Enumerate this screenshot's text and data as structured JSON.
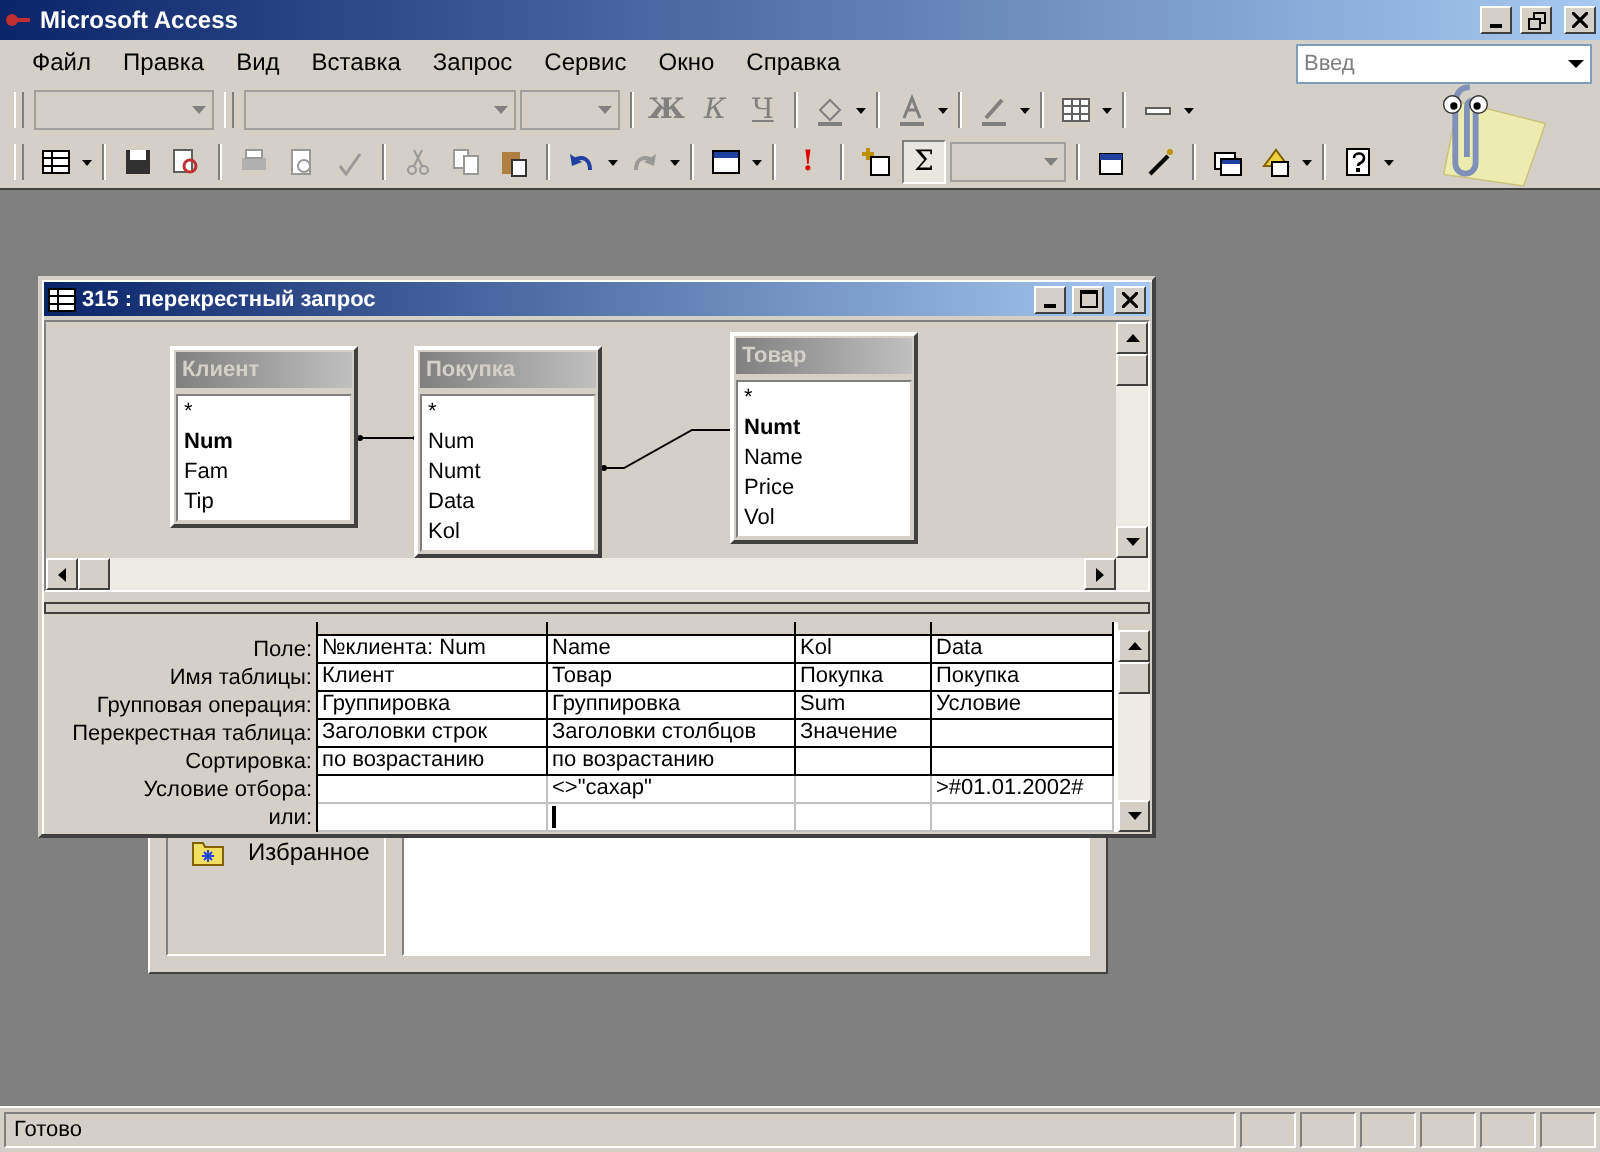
{
  "window": {
    "title": "Microsoft Access"
  },
  "menu": [
    {
      "label": "Файл"
    },
    {
      "label": "Правка"
    },
    {
      "label": "Вид"
    },
    {
      "label": "Вставка"
    },
    {
      "label": "Запрос"
    },
    {
      "label": "Сервис"
    },
    {
      "label": "Окно"
    },
    {
      "label": "Справка"
    }
  ],
  "help_box": {
    "placeholder": "Введ"
  },
  "formatting_toolbar": {
    "glyphs": [
      "Ж",
      "К",
      "Ч"
    ]
  },
  "query_toolbar": {
    "run_glyph": "!",
    "totals_glyph": "Σ"
  },
  "query_window": {
    "title": "315 : перекрестный запрос",
    "tables": [
      {
        "name": "Клиент",
        "fields": [
          {
            "name": "*",
            "key": false
          },
          {
            "name": "Num",
            "key": true
          },
          {
            "name": "Fam",
            "key": false
          },
          {
            "name": "Tip",
            "key": false
          }
        ]
      },
      {
        "name": "Покупка",
        "fields": [
          {
            "name": "*",
            "key": false
          },
          {
            "name": "Num",
            "key": false
          },
          {
            "name": "Numt",
            "key": false
          },
          {
            "name": "Data",
            "key": false
          },
          {
            "name": "Kol",
            "key": false
          }
        ]
      },
      {
        "name": "Товар",
        "fields": [
          {
            "name": "*",
            "key": false
          },
          {
            "name": "Numt",
            "key": true
          },
          {
            "name": "Name",
            "key": false
          },
          {
            "name": "Price",
            "key": false
          },
          {
            "name": "Vol",
            "key": false
          }
        ]
      }
    ],
    "grid": {
      "row_labels": [
        "Поле:",
        "Имя таблицы:",
        "Групповая операция:",
        "Перекрестная таблица:",
        "Сортировка:",
        "Условие отбора:",
        "или:"
      ],
      "columns": [
        {
          "cells": [
            "№клиента: Num",
            "Клиент",
            "Группировка",
            "Заголовки строк",
            "по возрастанию",
            "",
            ""
          ]
        },
        {
          "cells": [
            "Name",
            "Товар",
            "Группировка",
            "Заголовки столбцов",
            "по возрастанию",
            "<>\"сахар\"",
            ""
          ]
        },
        {
          "cells": [
            "Kol",
            "Покупка",
            "Sum",
            "Значение",
            "",
            "",
            ""
          ]
        },
        {
          "cells": [
            "Data",
            "Покупка",
            "Условие",
            "",
            "",
            ">#01.01.2002#",
            ""
          ]
        }
      ]
    }
  },
  "database_window": {
    "groups": [
      {
        "label": "Избранное"
      }
    ]
  },
  "status_bar": {
    "text": "Готово"
  }
}
